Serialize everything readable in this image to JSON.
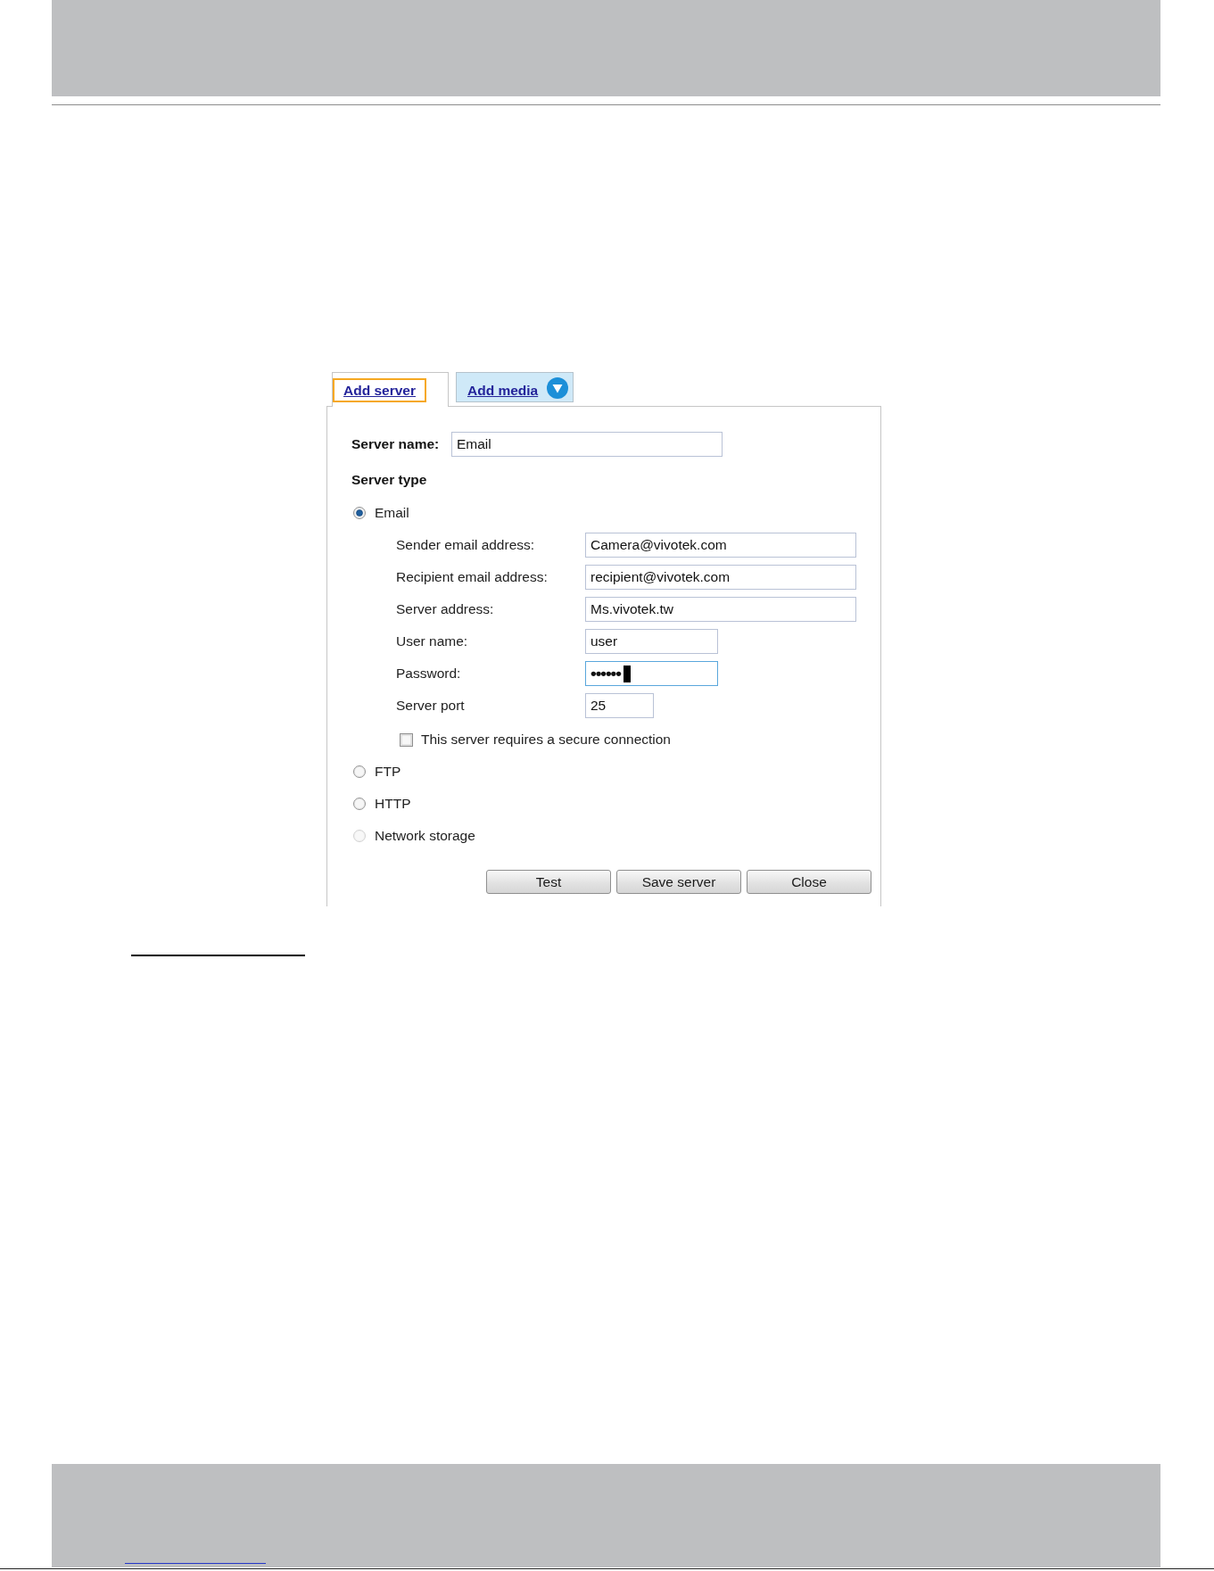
{
  "tabs": [
    {
      "label": "Add server",
      "selected": true,
      "focused": true,
      "kind": "link"
    },
    {
      "label": "Add media",
      "selected": false,
      "focused": false,
      "kind": "dropdown"
    }
  ],
  "server_name": {
    "label": "Server name:",
    "value": "Email"
  },
  "server_type": {
    "heading": "Server type",
    "options": [
      {
        "label": "Email",
        "selected": true,
        "disabled": false,
        "settings": {
          "fields": [
            {
              "label": "Sender email address:",
              "value": "Camera@vivotek.com",
              "kind": "text",
              "focused": false
            },
            {
              "label": "Recipient email address:",
              "value": "recipient@vivotek.com",
              "kind": "text",
              "focused": false
            },
            {
              "label": "Server address:",
              "value": "Ms.vivotek.tw",
              "kind": "text",
              "focused": false
            },
            {
              "label": "User name:",
              "value": "user",
              "kind": "text",
              "focused": false
            },
            {
              "label": "Password:",
              "value": "••••••",
              "kind": "password",
              "focused": true
            },
            {
              "label": "Server port",
              "value": "25",
              "kind": "text",
              "focused": false
            }
          ],
          "secure_connection": {
            "label": "This server requires a secure connection",
            "checked": false
          }
        }
      },
      {
        "label": "FTP",
        "selected": false,
        "disabled": false
      },
      {
        "label": "HTTP",
        "selected": false,
        "disabled": false
      },
      {
        "label": "Network storage",
        "selected": false,
        "disabled": true
      }
    ]
  },
  "buttons": [
    "Test",
    "Save server",
    "Close"
  ]
}
